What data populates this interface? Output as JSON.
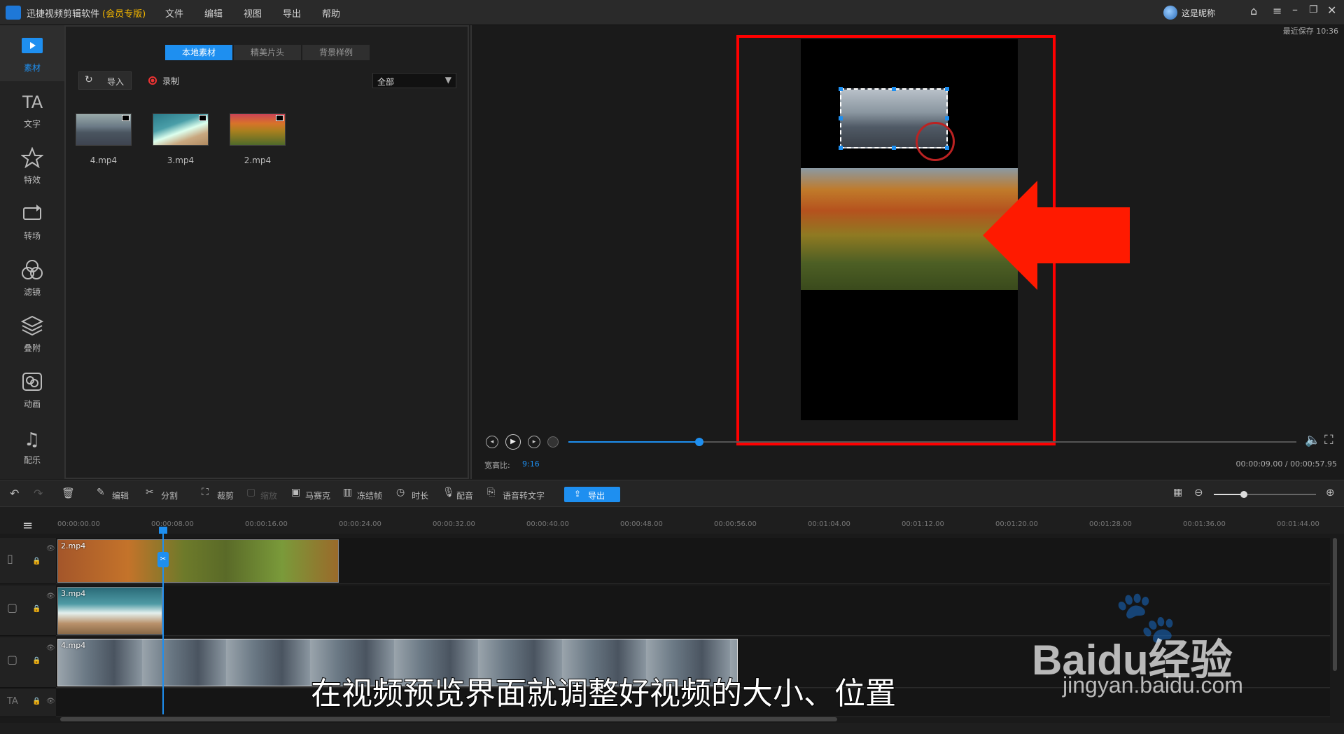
{
  "app": {
    "title": "迅捷视频剪辑软件",
    "edition": "(会员专版)",
    "menu": [
      "文件",
      "编辑",
      "视图",
      "导出",
      "帮助"
    ],
    "user": "这是昵称",
    "last_saved": "最近保存 10:36"
  },
  "sidebar": {
    "items": [
      {
        "label": "素材",
        "icon": "folder-play-icon"
      },
      {
        "label": "文字",
        "icon": "text-icon"
      },
      {
        "label": "特效",
        "icon": "star-icon"
      },
      {
        "label": "转场",
        "icon": "transition-icon"
      },
      {
        "label": "滤镜",
        "icon": "filter-icon"
      },
      {
        "label": "叠附",
        "icon": "layers-icon"
      },
      {
        "label": "动画",
        "icon": "animation-icon"
      },
      {
        "label": "配乐",
        "icon": "music-icon"
      }
    ]
  },
  "media": {
    "tabs": [
      "本地素材",
      "精美片头",
      "背景样例"
    ],
    "import": "导入",
    "record": "录制",
    "filter": "全部",
    "files": [
      "4.mp4",
      "3.mp4",
      "2.mp4"
    ]
  },
  "preview": {
    "aspect_label": "宽高比:",
    "aspect_value": "9:16",
    "time": "00:00:09.00 / 00:00:57.95",
    "progress": 0.18
  },
  "toolbar": {
    "edit": "编辑",
    "split": "分割",
    "crop": "裁剪",
    "scale": "缩放",
    "mosaic": "马赛克",
    "freeze": "冻结帧",
    "duration": "时长",
    "voice": "配音",
    "speech": "语音转文字",
    "export": "导出"
  },
  "ruler": [
    "00:00:00.00",
    "00:00:08.00",
    "00:00:16.00",
    "00:00:24.00",
    "00:00:32.00",
    "00:00:40.00",
    "00:00:48.00",
    "00:00:56.00",
    "00:01:04.00",
    "00:01:12.00",
    "00:01:20.00",
    "00:01:28.00",
    "00:01:36.00",
    "00:01:44.00"
  ],
  "tracks": {
    "clip1": "2.mp4",
    "clip2": "3.mp4",
    "clip3": "4.mp4"
  },
  "subtitle": "在视频预览界面就调整好视频的大小、位置",
  "watermark": {
    "brand": "Baidu经验",
    "url": "jingyan.baidu.com"
  },
  "colors": {
    "accent": "#1e90ff",
    "annotation_red": "#ff0000"
  }
}
